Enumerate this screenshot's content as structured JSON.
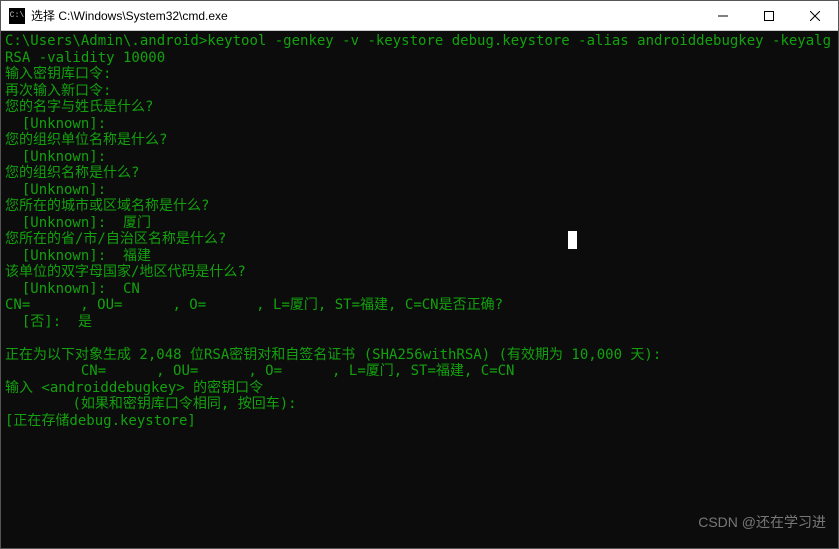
{
  "titlebar": {
    "title": "选择 C:\\Windows\\System32\\cmd.exe",
    "icon_label": "cmd"
  },
  "terminal": {
    "prompt": "C:\\Users\\Admin\\.android>",
    "command": "keytool -genkey -v -keystore debug.keystore -alias androiddebugkey -keyalg RSA -validity 10000",
    "lines": {
      "l1": "输入密钥库口令:",
      "l2": "再次输入新口令:",
      "l3": "您的名字与姓氏是什么?",
      "l4a": "  [Unknown]:  ",
      "l5": "您的组织单位名称是什么?",
      "l6a": "  [Unknown]:  ",
      "l7": "您的组织名称是什么?",
      "l8a": "  [Unknown]:  ",
      "l9": "您所在的城市或区域名称是什么?",
      "l10": "  [Unknown]:  厦门",
      "l11": "您所在的省/市/自治区名称是什么?",
      "l12": "  [Unknown]:  福建",
      "l13": "该单位的双字母国家/地区代码是什么?",
      "l14": "  [Unknown]:  CN",
      "l15a": "CN=",
      "l15b": ", OU=",
      "l15c": ", O=",
      "l15d": ", L=厦门, ST=福建, C=CN是否正确?",
      "l16": "  [否]:  是",
      "l17": "",
      "l18": "正在为以下对象生成 2,048 位RSA密钥对和自签名证书 (SHA256withRSA) (有效期为 10,000 天):",
      "l19a": "         CN=",
      "l19b": ", OU=",
      "l19c": ", O=",
      "l19d": ", L=厦门, ST=福建, C=CN",
      "l20": "输入 <androiddebugkey> 的密钥口令",
      "l21": "        (如果和密钥库口令相同, 按回车):",
      "l22": "[正在存储debug.keystore]"
    }
  },
  "watermark": "CSDN @还在学习进"
}
